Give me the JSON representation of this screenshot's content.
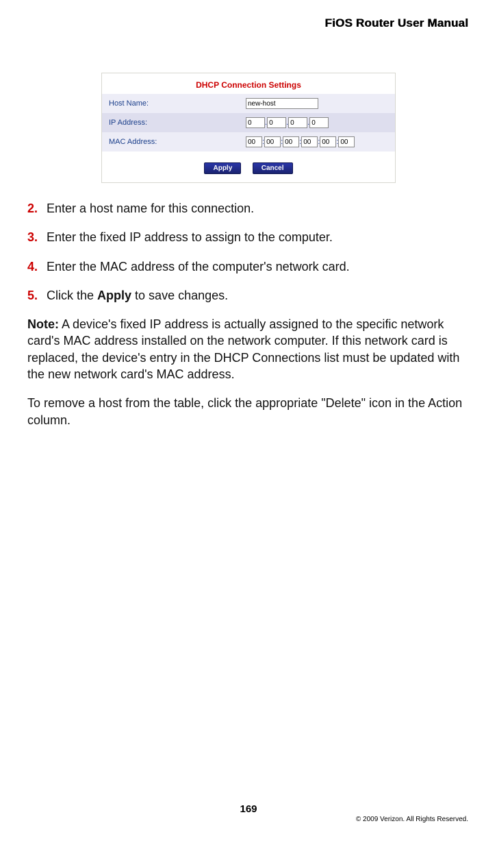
{
  "header": {
    "title": "FiOS Router User Manual"
  },
  "panel": {
    "title": "DHCP Connection Settings",
    "rows": {
      "host_label": "Host Name:",
      "ip_label": "IP Address:",
      "mac_label": "MAC Address:"
    },
    "values": {
      "host": "new-host",
      "ip": [
        "0",
        "0",
        "0",
        "0"
      ],
      "mac": [
        "00",
        "00",
        "00",
        "00",
        "00",
        "00"
      ]
    },
    "buttons": {
      "apply": "Apply",
      "cancel": "Cancel"
    },
    "sep": {
      "dot": ".",
      "colon": ":"
    }
  },
  "steps": {
    "s2_num": "2.",
    "s2_text": "Enter a host name for this connection.",
    "s3_num": "3.",
    "s3_text": "Enter the fixed IP address to assign to the computer.",
    "s4_num": "4.",
    "s4_text": "Enter the MAC address of the computer's network card.",
    "s5_num": "5.",
    "s5_text_a": "Click the ",
    "s5_bold": "Apply",
    "s5_text_b": " to save changes."
  },
  "note": {
    "label": "Note:",
    "text": " A device's fixed IP address is actually assigned to the specific network card's MAC address installed on the network computer. If this network card is replaced, the device's entry in the DHCP Connections list must be updated with the new network card's MAC address."
  },
  "para_remove": "To remove a host from the table, click the appropriate \"Delete\" icon in the Action column.",
  "footer": {
    "page": "169",
    "copyright": "© 2009 Verizon. All Rights Reserved."
  }
}
